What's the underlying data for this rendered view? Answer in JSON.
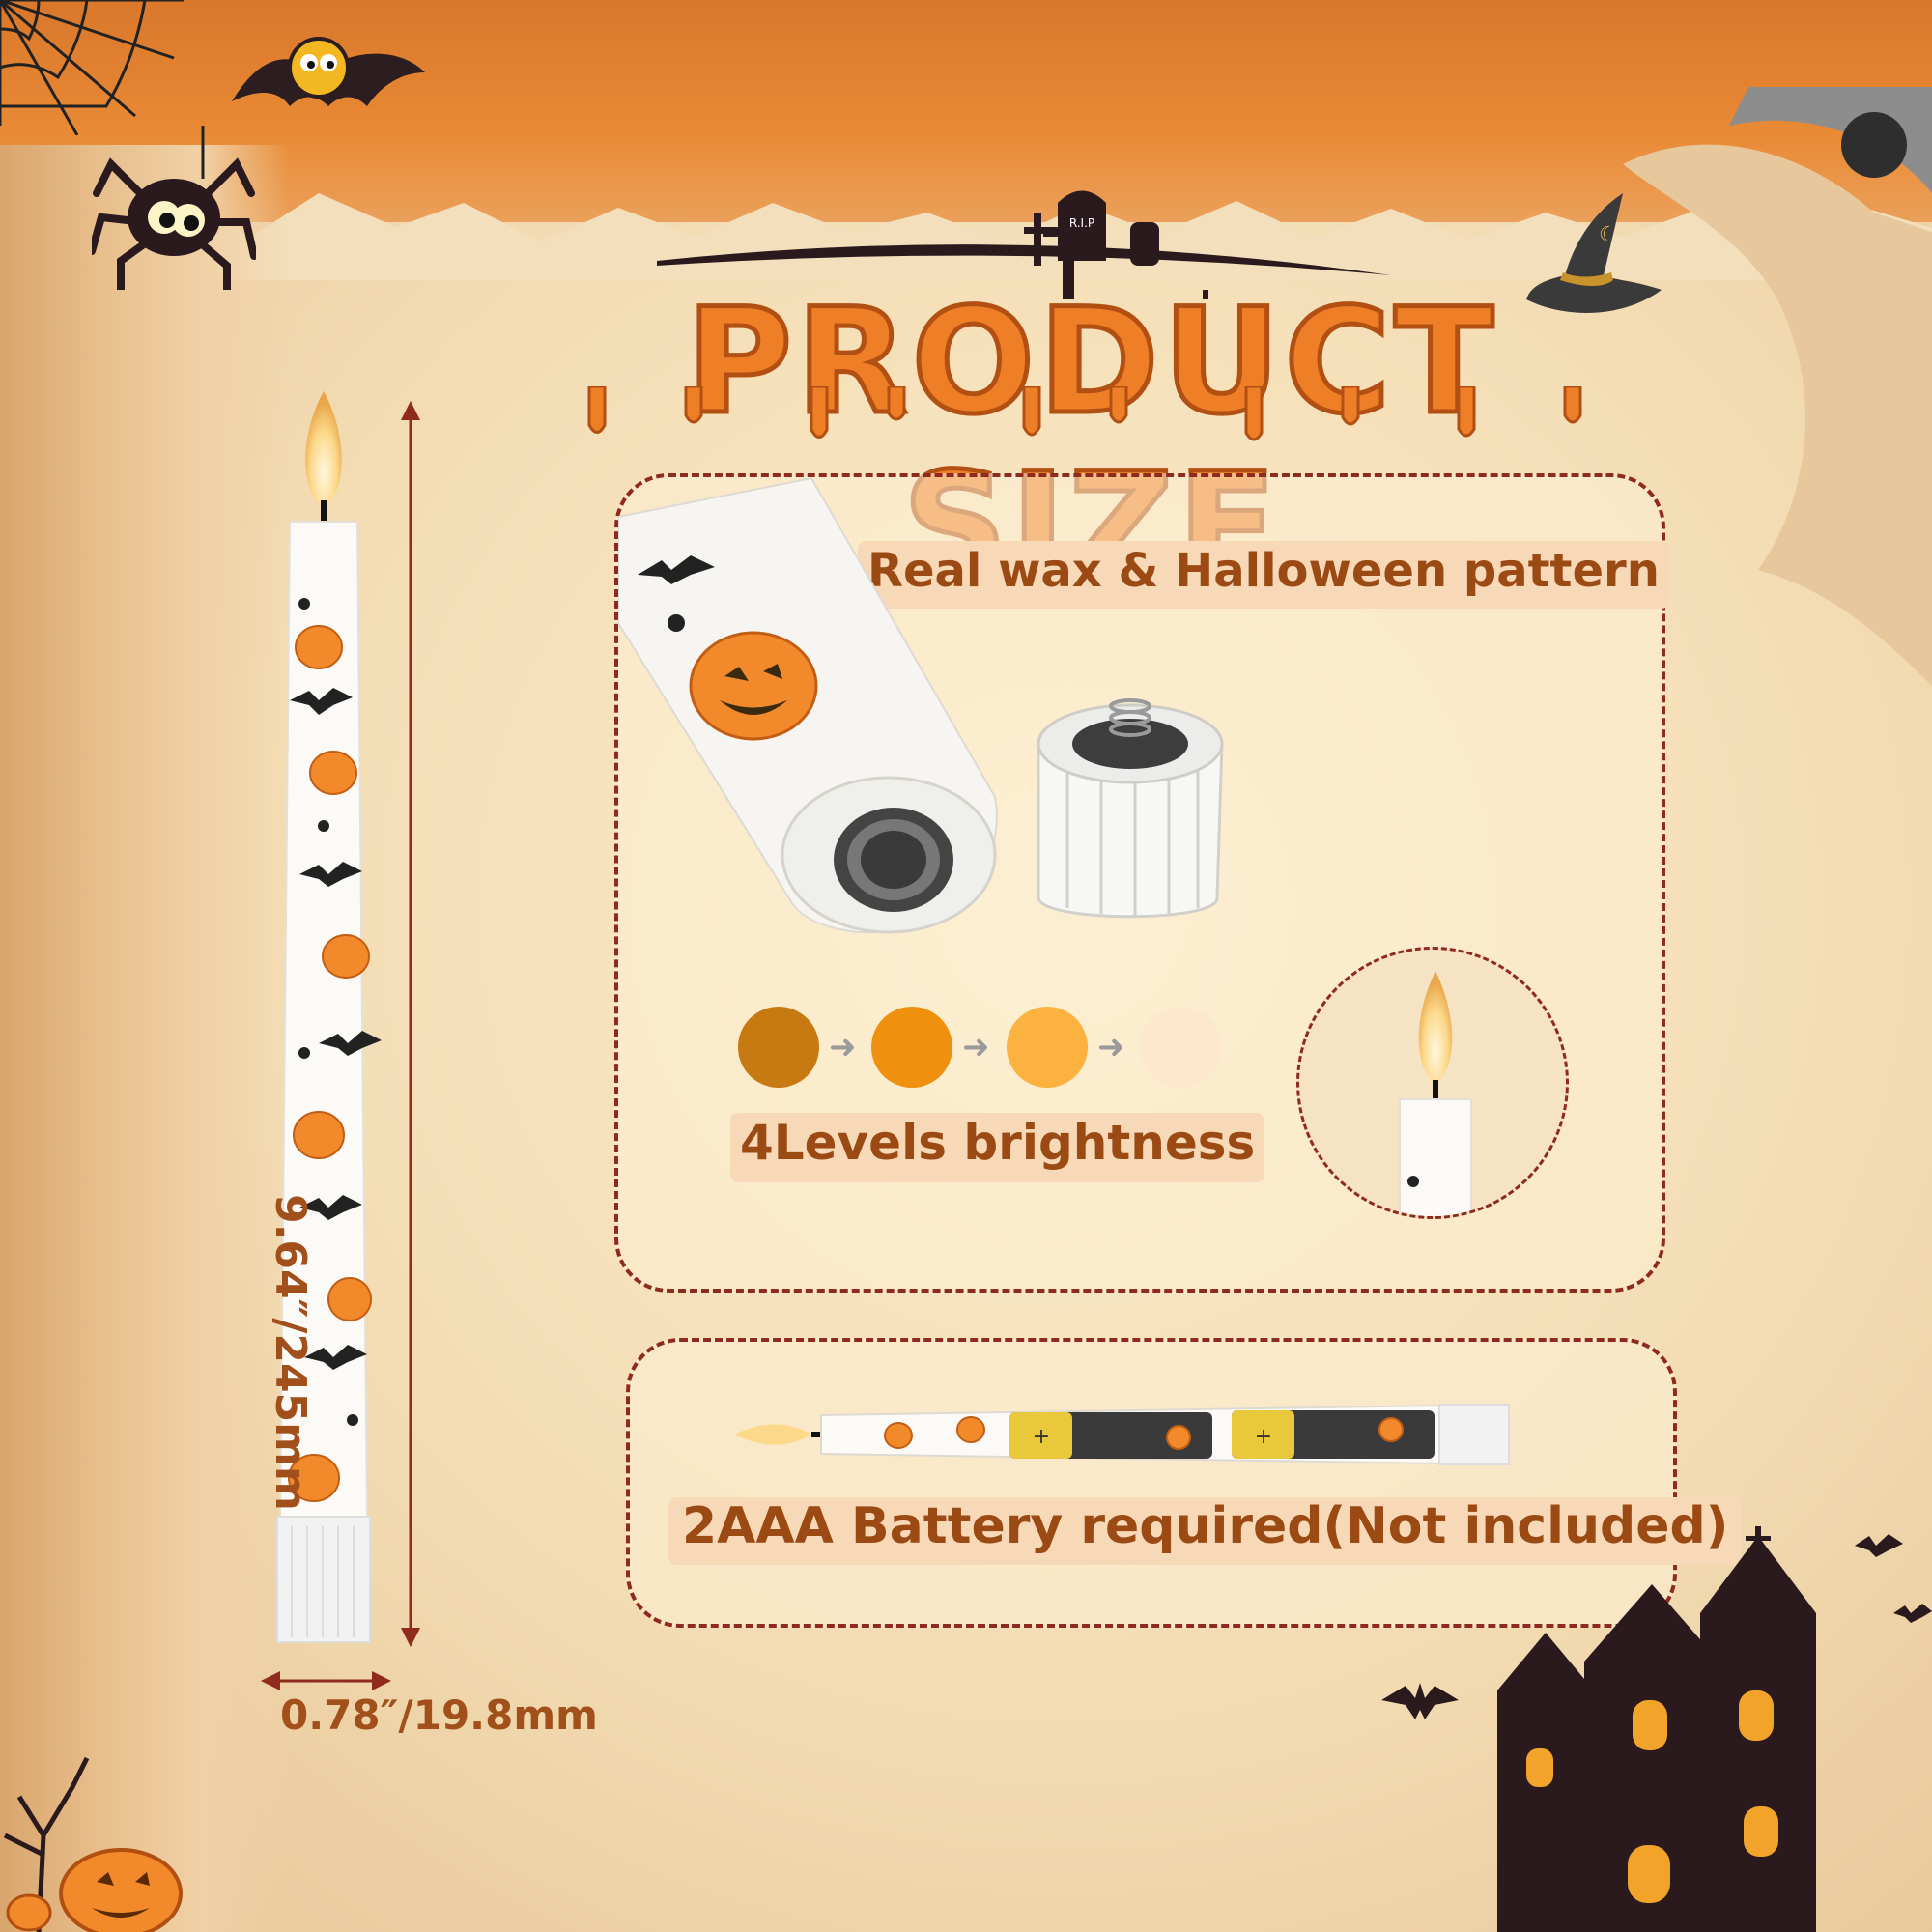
{
  "title": "PRODUCT SIZE",
  "grave_text": "R.I.P",
  "features": {
    "wax_label": "Real wax & Halloween pattern",
    "brightness_label": "4Levels brightness",
    "battery_label": "2AAA Battery required(Not included)"
  },
  "brightness_levels": [
    "#c77a12",
    "#f0900f",
    "#fbb23e",
    "#fde8cf"
  ],
  "dimensions": {
    "height": "9.64″/245mm",
    "width": "0.78″/19.8mm"
  },
  "colors": {
    "title_orange": "#ef7f26",
    "border_red": "#8f2a1f",
    "label_brown": "#9b4a14"
  }
}
